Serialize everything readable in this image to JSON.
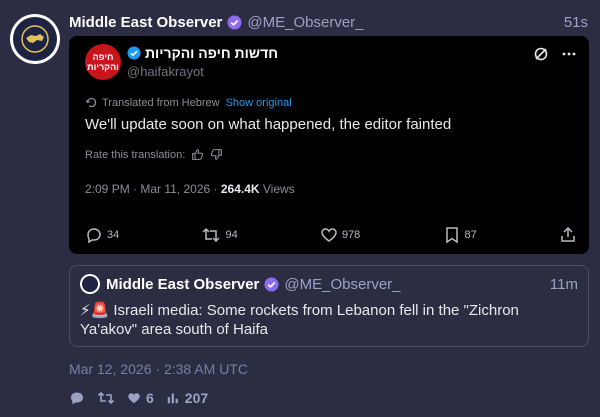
{
  "post": {
    "author_name": "Middle East Observer",
    "author_handle": "@ME_Observer_",
    "time": "51s",
    "date": "Mar 12, 2026 · 2:38 AM UTC",
    "stats": {
      "likes": "6",
      "views": "207"
    }
  },
  "embed": {
    "source_name": "חדשות חיפה והקריות",
    "source_handle": "@haifakrayot",
    "avatar_text": "חיפה והקריות",
    "translated_label": "Translated from Hebrew",
    "show_original": "Show original",
    "text": "We'll update soon on what happened, the editor fainted",
    "rate_label": "Rate this translation:",
    "timestamp": "2:09 PM · Mar 11, 2026 · ",
    "views_count": "264.4K",
    "views_label": " Views",
    "replies": "34",
    "reposts": "94",
    "likes": "978",
    "bookmarks": "87"
  },
  "quote": {
    "author_name": "Middle East Observer",
    "author_handle": "@ME_Observer_",
    "time": "11m",
    "text": "⚡🚨 Israeli media: Some rockets from Lebanon fell in the \"Zichron Ya'akov\" area south of Haifa"
  },
  "colors": {
    "background": "#2c2d42",
    "verified": "#8c6cf0",
    "link": "#1d9bf0"
  }
}
